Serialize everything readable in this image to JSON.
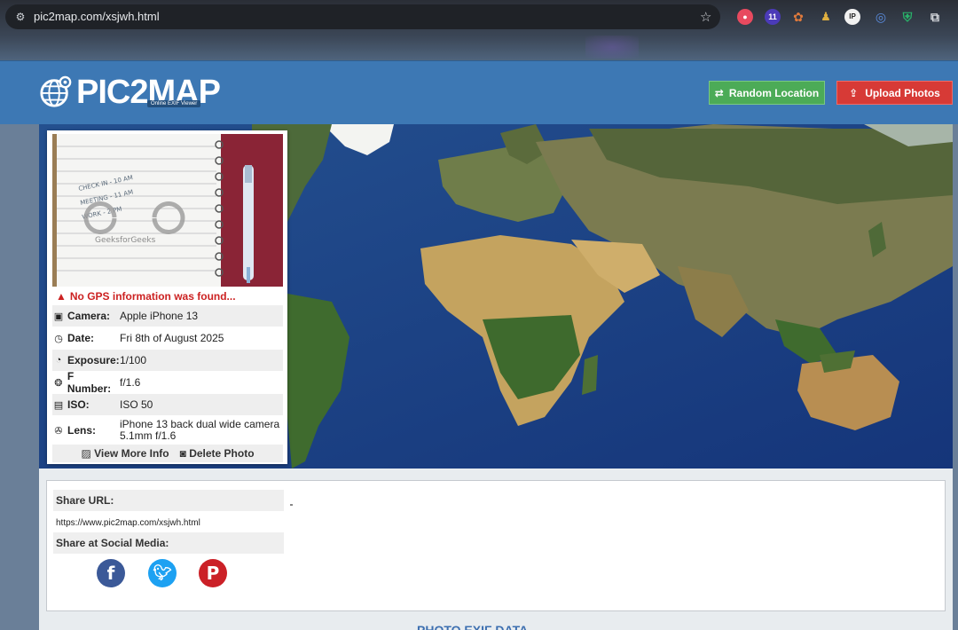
{
  "browser": {
    "url": "pic2map.com/xsjwh.html",
    "extension_badge": "11",
    "extensions": [
      "record-icon",
      "badge-extension-icon",
      "cookie-icon",
      "puzzle-color-icon",
      "ip-icon",
      "edge-copilot-icon",
      "shield-icon",
      "extensions-icon"
    ]
  },
  "header": {
    "logo_text": "PIC2MAP",
    "logo_subtext": "Online EXIF Viewer",
    "random_location_label": "Random Location",
    "upload_photos_label": "Upload Photos",
    "colors": {
      "header_bg": "#3d78b4",
      "random_btn": "#4cab57",
      "upload_btn": "#d73a36"
    }
  },
  "info_card": {
    "no_gps_message": "No GPS information was found...",
    "rows": [
      {
        "label": "Camera:",
        "value": "Apple iPhone 13",
        "icon": "camera-icon"
      },
      {
        "label": "Date:",
        "value": "Fri 8th of August 2025",
        "icon": "clock-icon"
      },
      {
        "label": "Exposure:",
        "value": "1/100",
        "icon": "timer-icon"
      },
      {
        "label": "F Number:",
        "value": "f/1.6",
        "icon": "aperture-icon"
      },
      {
        "label": "ISO:",
        "value": "ISO 50",
        "icon": "iso-icon"
      },
      {
        "label": "Lens:",
        "value": "iPhone 13 back dual wide camera 5.1mm f/1.6",
        "icon": "lens-icon"
      }
    ],
    "view_more_label": "View More Info",
    "delete_label": "Delete Photo",
    "photo_notes": [
      "CHECK IN - 10 AM",
      "MEETING - 11 AM",
      "WORK - 2 PM",
      "GeeksforGeeks"
    ]
  },
  "share": {
    "share_url_label": "Share URL:",
    "share_url": "https://www.pic2map.com/xsjwh.html",
    "social_label": "Share at Social Media:",
    "social_icons": [
      "facebook-icon",
      "twitter-icon",
      "pinterest-icon"
    ]
  },
  "exif_heading": "PHOTO EXIF DATA"
}
